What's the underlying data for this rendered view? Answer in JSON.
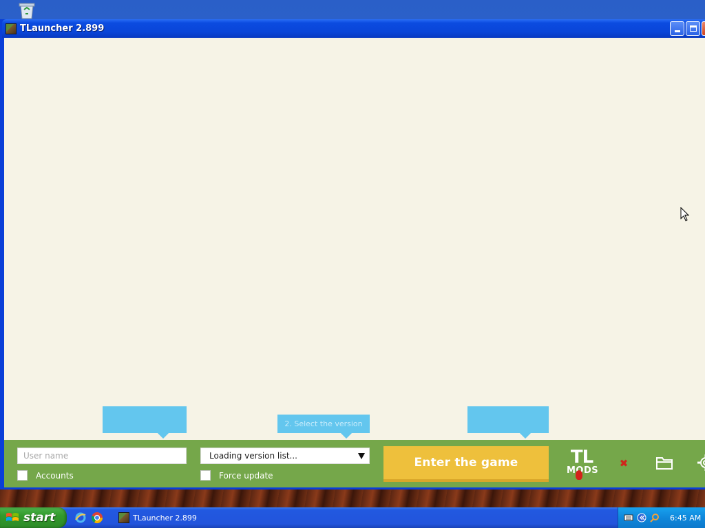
{
  "window": {
    "title": "TLauncher 2.899"
  },
  "login": {
    "username_placeholder": "User name",
    "accounts_label": "Accounts"
  },
  "version": {
    "selected": "Loading version list...",
    "force_update_label": "Force update"
  },
  "tooltips": {
    "username_tip": "",
    "version_tip": "2. Select the version",
    "enter_tip": ""
  },
  "play": {
    "enter_label": "Enter the game"
  },
  "tlmods": {
    "top": "TL",
    "bottom": "MODS"
  },
  "taskbar": {
    "start_label": "start",
    "task_title": "TLauncher 2.899",
    "clock": "6:45 AM"
  },
  "colors": {
    "green_bar": "#75a74a",
    "enter_button": "#eec03c",
    "tooltip": "#63c6ee",
    "content_bg": "#f6f3e6"
  }
}
